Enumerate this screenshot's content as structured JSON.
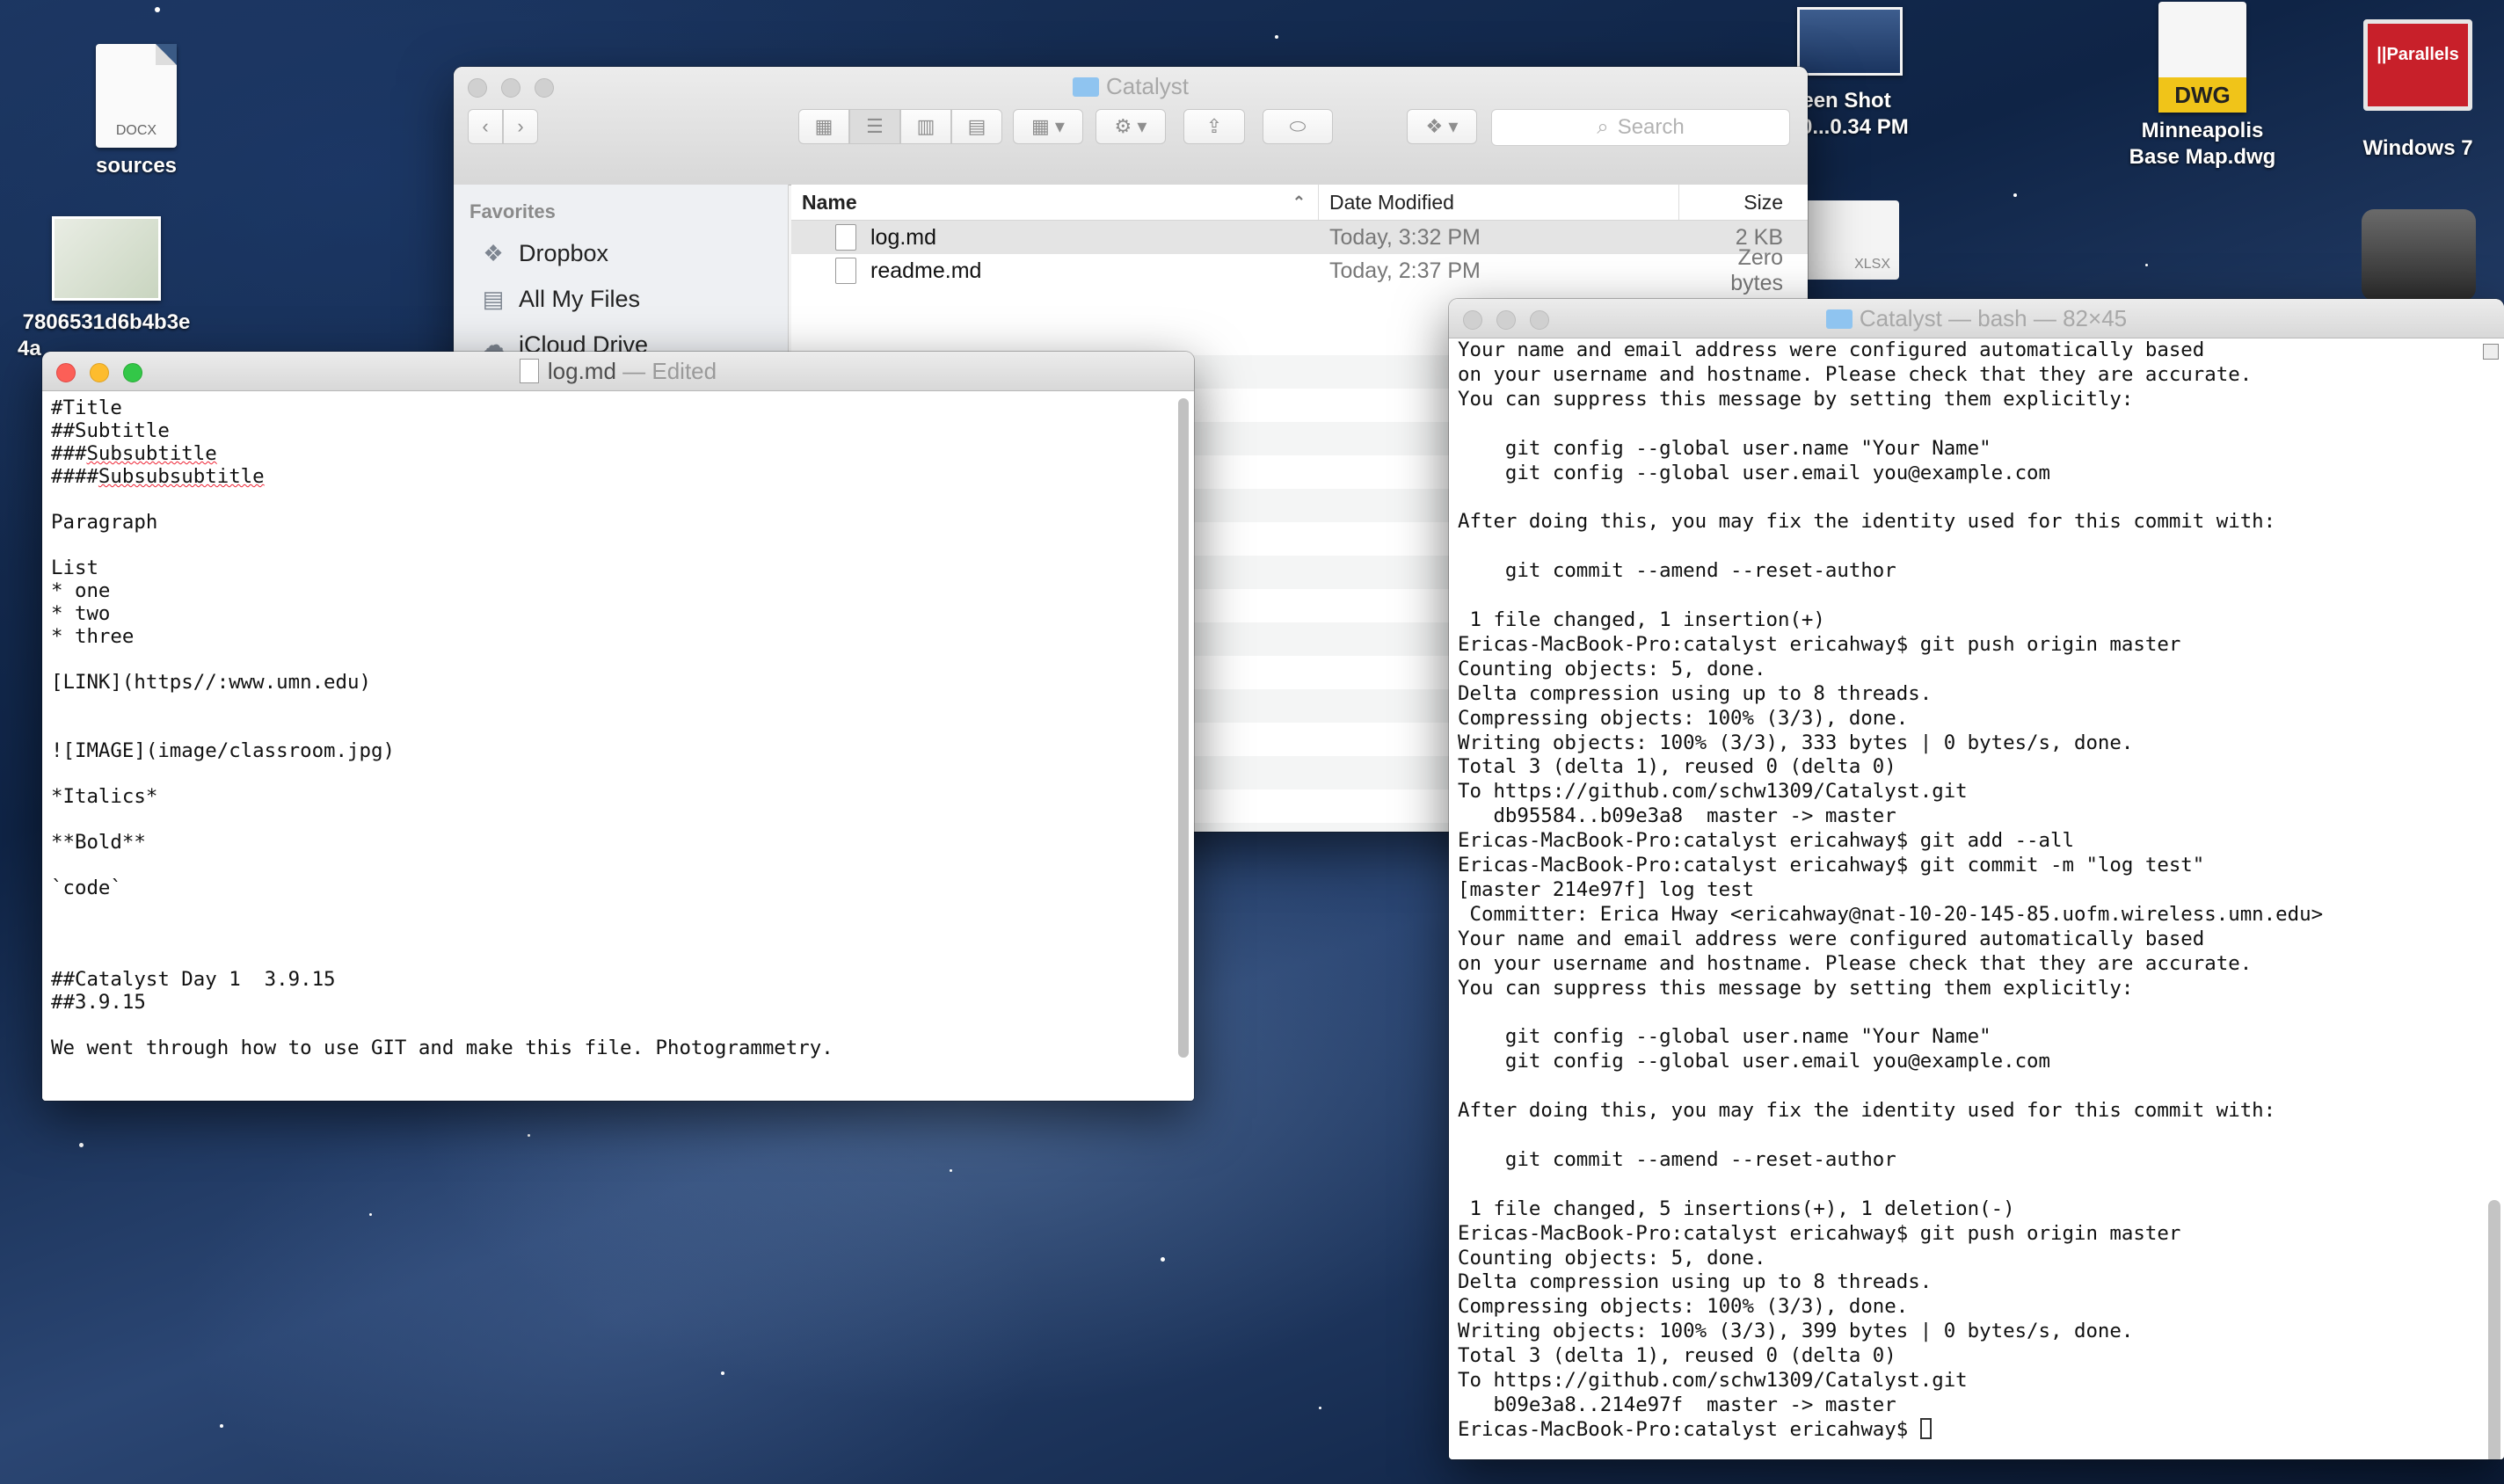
{
  "desktop": {
    "icons": {
      "sources": {
        "label": "sources",
        "tag": "DOCX"
      },
      "image": {
        "label_line1": "7806531d6b4b3e",
        "label_line2": "4a"
      },
      "screenshot": {
        "label_line1": "reen Shot",
        "label_line2": "-0...0.34 PM"
      },
      "dwg": {
        "label_line1": "Minneapolis",
        "label_line2": "Base Map.dwg",
        "tag": "DWG"
      },
      "windows7": {
        "label": "Windows 7",
        "badge": "||Parallels"
      },
      "xlsx": {
        "tag": "XLSX"
      }
    }
  },
  "finder": {
    "title": "Catalyst",
    "search_placeholder": "Search",
    "sidebar": {
      "header": "Favorites",
      "items": [
        {
          "label": "Dropbox",
          "icon": "dropbox-icon"
        },
        {
          "label": "All My Files",
          "icon": "all-files-icon"
        },
        {
          "label": "iCloud Drive",
          "icon": "cloud-icon"
        }
      ]
    },
    "columns": {
      "name": "Name",
      "date": "Date Modified",
      "size": "Size"
    },
    "files": [
      {
        "name": "log.md",
        "date": "Today, 3:32 PM",
        "size": "2 KB"
      },
      {
        "name": "readme.md",
        "date": "Today, 2:37 PM",
        "size": "Zero bytes"
      }
    ]
  },
  "textedit": {
    "title": "log.md",
    "status": "— Edited",
    "lines": {
      "l1": "#Title",
      "l2": "##Subtitle",
      "l3a": "###",
      "l3b": "Subsubtitle",
      "l4a": "####",
      "l4b": "Subsubsubtitle",
      "l5": "Paragraph",
      "l6": "List",
      "l7": "* one",
      "l8": "* two",
      "l9": "* three",
      "l10": "[LINK](https//:www.umn.edu)",
      "l11": "![IMAGE](image/classroom.jpg)",
      "l12": "*Italics*",
      "l13": "**Bold**",
      "l14": "`code`",
      "l15": "##Catalyst Day 1  3.9.15",
      "l16": "##3.9.15",
      "l17": "We went through how to use GIT and make this file. Photogrammetry."
    }
  },
  "terminal": {
    "title": "Catalyst — bash — 82×45",
    "output": "Your name and email address were configured automatically based\non your username and hostname. Please check that they are accurate.\nYou can suppress this message by setting them explicitly:\n\n    git config --global user.name \"Your Name\"\n    git config --global user.email you@example.com\n\nAfter doing this, you may fix the identity used for this commit with:\n\n    git commit --amend --reset-author\n\n 1 file changed, 1 insertion(+)\nEricas-MacBook-Pro:catalyst ericahway$ git push origin master\nCounting objects: 5, done.\nDelta compression using up to 8 threads.\nCompressing objects: 100% (3/3), done.\nWriting objects: 100% (3/3), 333 bytes | 0 bytes/s, done.\nTotal 3 (delta 1), reused 0 (delta 0)\nTo https://github.com/schw1309/Catalyst.git\n   db95584..b09e3a8  master -> master\nEricas-MacBook-Pro:catalyst ericahway$ git add --all\nEricas-MacBook-Pro:catalyst ericahway$ git commit -m \"log test\"\n[master 214e97f] log test\n Committer: Erica Hway <ericahway@nat-10-20-145-85.uofm.wireless.umn.edu>\nYour name and email address were configured automatically based\non your username and hostname. Please check that they are accurate.\nYou can suppress this message by setting them explicitly:\n\n    git config --global user.name \"Your Name\"\n    git config --global user.email you@example.com\n\nAfter doing this, you may fix the identity used for this commit with:\n\n    git commit --amend --reset-author\n\n 1 file changed, 5 insertions(+), 1 deletion(-)\nEricas-MacBook-Pro:catalyst ericahway$ git push origin master\nCounting objects: 5, done.\nDelta compression using up to 8 threads.\nCompressing objects: 100% (3/3), done.\nWriting objects: 100% (3/3), 399 bytes | 0 bytes/s, done.\nTotal 3 (delta 1), reused 0 (delta 0)\nTo https://github.com/schw1309/Catalyst.git\n   b09e3a8..214e97f  master -> master",
    "prompt": "Ericas-MacBook-Pro:catalyst ericahway$ "
  }
}
